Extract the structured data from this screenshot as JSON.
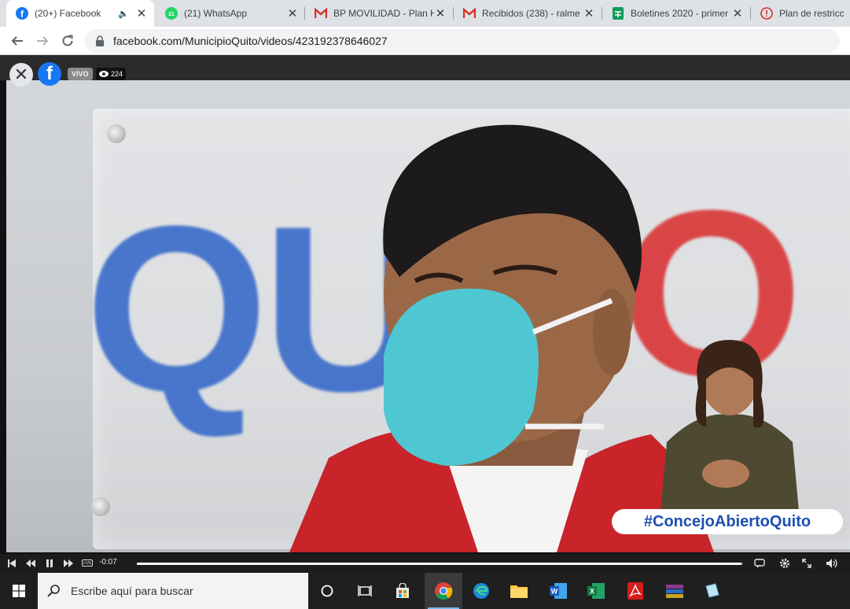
{
  "browser": {
    "tabs": [
      {
        "title": "(20+) Facebook",
        "icon": "facebook-icon",
        "active": true,
        "audio": true
      },
      {
        "title": "(21) WhatsApp",
        "icon": "whatsapp-icon",
        "badge": "21"
      },
      {
        "title": "BP MOVILIDAD - Plan H",
        "icon": "gmail-icon"
      },
      {
        "title": "Recibidos (238) - ralme",
        "icon": "gmail-icon"
      },
      {
        "title": "Boletines 2020 - primer",
        "icon": "sheets-icon"
      },
      {
        "title": "Plan de restricció",
        "icon": "info-icon"
      }
    ],
    "url": "facebook.com/MunicipioQuito/videos/423192378646027"
  },
  "video": {
    "live_label": "VIVO",
    "viewer_count": "224",
    "hashtag": "#ConcejoAbiertoQuito",
    "time_remaining": "-0:07",
    "live_indicator": "LIVE",
    "progress": 0.997
  },
  "taskbar": {
    "search_placeholder": "Escribe aquí para buscar",
    "apps": [
      "cortana-icon",
      "task-view-icon",
      "store-icon",
      "chrome-icon",
      "edge-icon",
      "file-explorer-icon",
      "word-icon",
      "excel-icon",
      "acrobat-icon",
      "winrar-icon",
      "notes-icon"
    ]
  },
  "colors": {
    "facebook_blue": "#1877f2",
    "quito_blue": "#2f64c8",
    "quito_red": "#d92b2b"
  }
}
